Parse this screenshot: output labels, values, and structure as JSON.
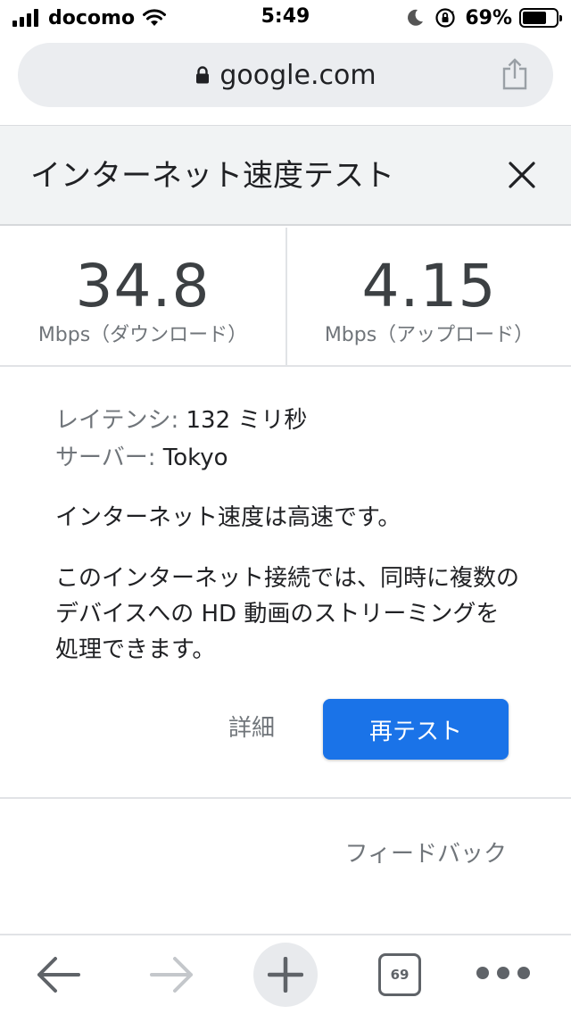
{
  "status_bar": {
    "carrier": "docomo",
    "time": "5:49",
    "battery_percent": "69%",
    "icons": [
      "signal-icon",
      "wifi-icon",
      "moon-icon",
      "rotation-lock-icon",
      "battery-icon"
    ]
  },
  "url_bar": {
    "domain": "google.com",
    "icons": [
      "lock-icon",
      "share-icon"
    ]
  },
  "header": {
    "title": "インターネット速度テスト",
    "close_icon": "close-icon"
  },
  "speeds": {
    "download_value": "34.8",
    "download_unit": "Mbps（ダウンロード）",
    "upload_value": "4.15",
    "upload_unit": "Mbps（アップロード）"
  },
  "details": {
    "latency_label": "レイテンシ:",
    "latency_value": " 132 ミリ秒",
    "server_label": "サーバー:",
    "server_value": " Tokyo",
    "verdict": "インターネット速度は高速です。",
    "description": "このインターネット接続では、同時に複数のデバイスへの HD 動画のストリーミングを処理できます。"
  },
  "actions": {
    "details_label": "詳細",
    "retest_label": "再テスト",
    "feedback_label": "フィードバック"
  },
  "toolbar": {
    "tab_count": "69",
    "icons": [
      "back-icon",
      "forward-icon",
      "new-tab-icon",
      "tabs-icon",
      "more-icon"
    ]
  },
  "colors": {
    "accent": "#1a73e8",
    "header_bg": "#f1f3f4",
    "url_bar_bg": "#ebedf0",
    "secondary_text": "#70757a"
  }
}
